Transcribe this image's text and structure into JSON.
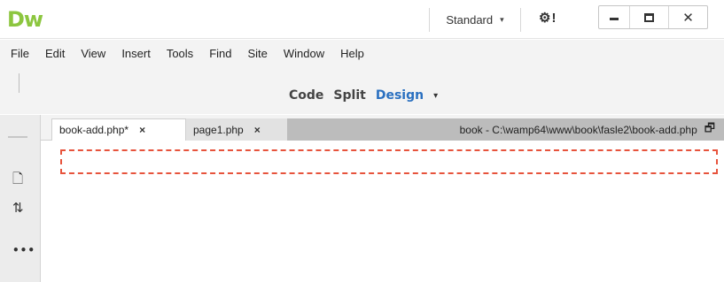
{
  "app": {
    "logo": "Dw"
  },
  "titlebar": {
    "workspace": "Standard",
    "workspace_caret": "▾",
    "gear_icon": "⚙!",
    "window_controls": {
      "close": "✕"
    }
  },
  "menu": {
    "items": [
      "File",
      "Edit",
      "View",
      "Insert",
      "Tools",
      "Find",
      "Site",
      "Window",
      "Help"
    ]
  },
  "document_toolbar": {
    "views": [
      "Code",
      "Split",
      "Design"
    ],
    "active_view": "Design",
    "views_caret": "▾"
  },
  "tabs": [
    {
      "label": "book-add.php*",
      "close": "×",
      "active": true
    },
    {
      "label": "page1.php",
      "close": "×",
      "active": false
    }
  ],
  "path": {
    "text": "book - C:\\wamp64\\www\\book\\fasle2\\book-add.php",
    "restore_icon": "🗗"
  },
  "left_tools": [
    {
      "name": "file-icon",
      "glyph": "🗋"
    },
    {
      "name": "sort-icon",
      "glyph": "⇅"
    },
    {
      "name": "more-icon",
      "glyph": "•••"
    }
  ],
  "colors": {
    "logo": "#8cc63f",
    "active_view": "#2a70c0",
    "dashed_border": "#e7533c"
  }
}
